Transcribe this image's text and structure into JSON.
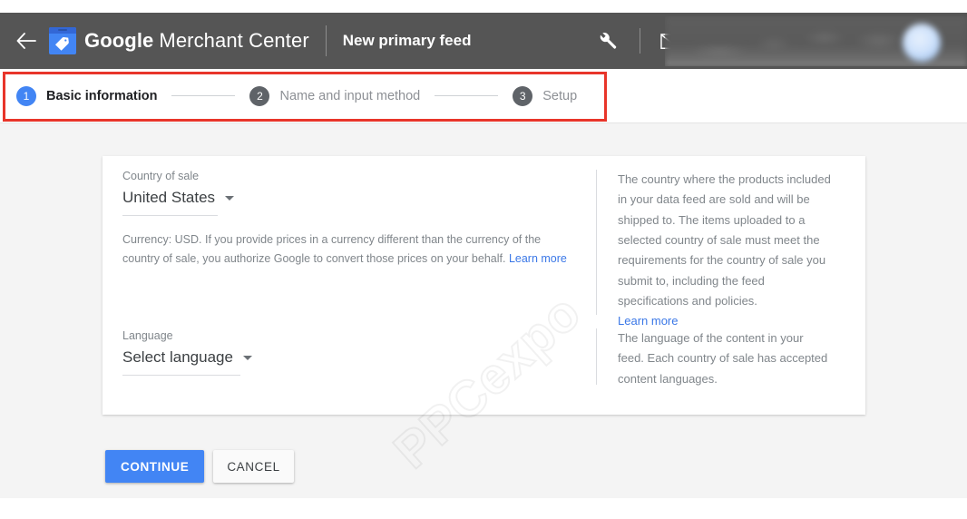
{
  "header": {
    "back_icon": "back-arrow-icon",
    "brand_icon": "merchant-tag-icon",
    "brand_google": "Google",
    "brand_rest": "Merchant Center",
    "page_title": "New primary feed",
    "tools_icon": "wrench-icon",
    "mail_icon": "envelope-icon",
    "help_icon": "question-mark-icon",
    "account_area": "redacted-account-info",
    "bg_color": "#555555"
  },
  "stepper": {
    "active_color": "#4285f4",
    "inactive_color": "#5f6368",
    "steps": [
      {
        "number": "1",
        "label": "Basic information",
        "state": "active"
      },
      {
        "number": "2",
        "label": "Name and input method",
        "state": "inactive"
      },
      {
        "number": "3",
        "label": "Setup",
        "state": "inactive"
      }
    ]
  },
  "annotation": {
    "color": "#e8352a",
    "shape": "rectangle-highlight"
  },
  "form": {
    "country": {
      "label": "Country of sale",
      "value": "United States",
      "help_text": "Currency: USD. If you provide prices in a currency different than the currency of the country of sale, you authorize Google to convert those prices on your behalf. ",
      "help_link": "Learn more"
    },
    "language": {
      "label": "Language",
      "value": "Select language"
    }
  },
  "side_help": {
    "country": {
      "text": "The country where the products included in your data feed are sold and will be shipped to. The items uploaded to a selected country of sale must meet the requirements for the country of sale you submit to, including the feed specifications and policies.",
      "link": "Learn more"
    },
    "language": {
      "text": "The language of the content in your feed. Each country of sale has accepted content languages."
    }
  },
  "actions": {
    "continue_label": "CONTINUE",
    "cancel_label": "CANCEL",
    "continue_color": "#4285f4"
  },
  "watermark": {
    "text": "PPCexpo"
  }
}
